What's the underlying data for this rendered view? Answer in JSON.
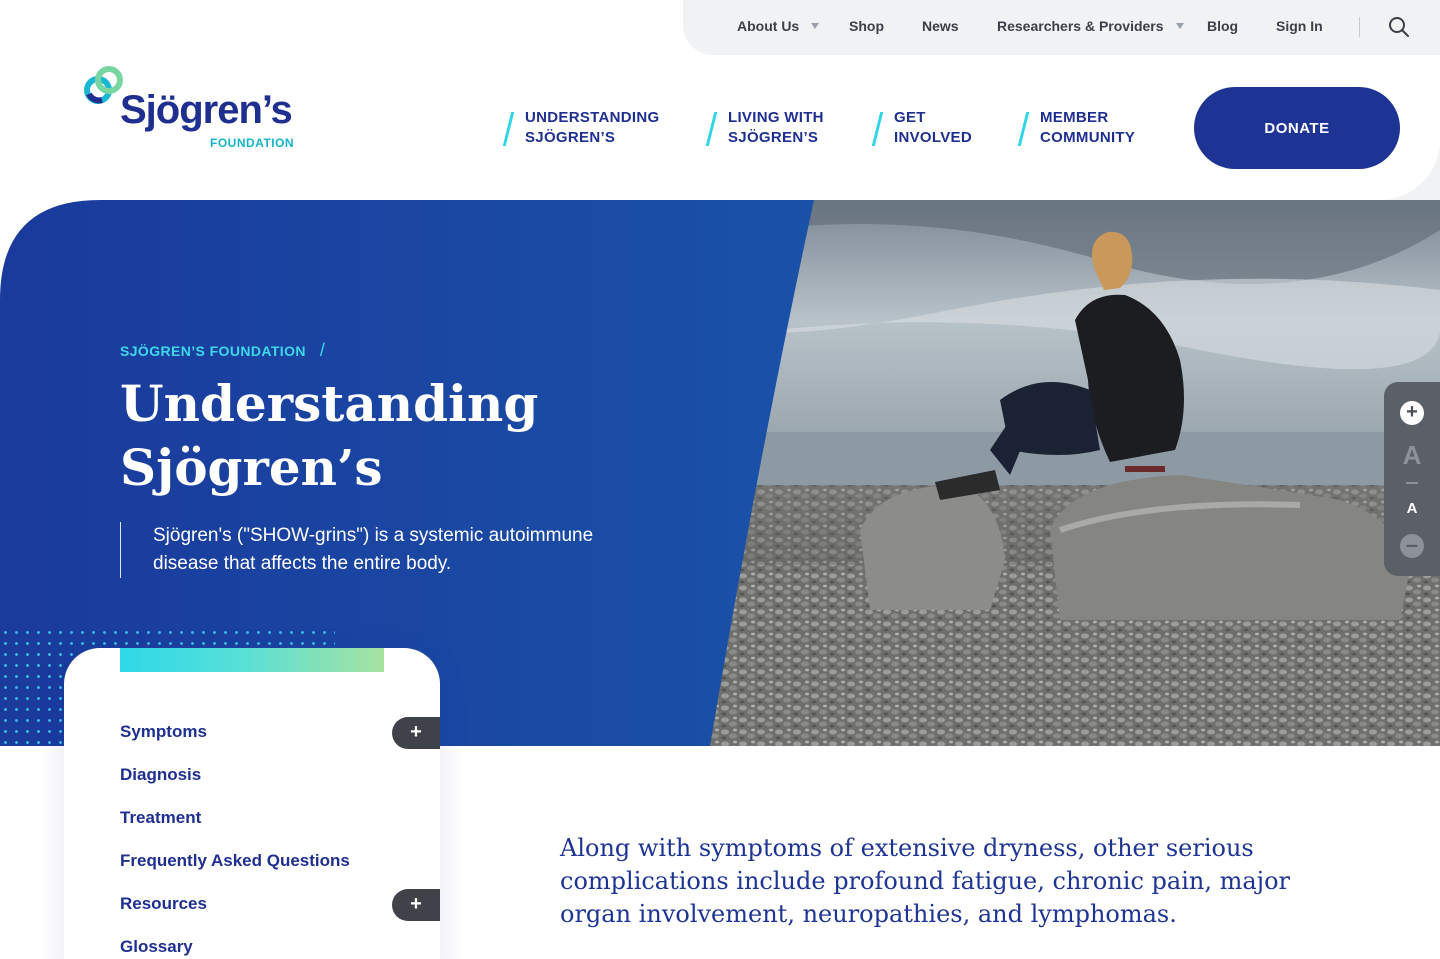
{
  "utility_nav": {
    "items": [
      {
        "label": "About Us",
        "has_dropdown": true
      },
      {
        "label": "Shop",
        "has_dropdown": false
      },
      {
        "label": "News",
        "has_dropdown": false
      },
      {
        "label": "Researchers & Providers",
        "has_dropdown": true
      },
      {
        "label": "Blog",
        "has_dropdown": false
      },
      {
        "label": "Sign In",
        "has_dropdown": false
      }
    ],
    "search_icon": "search-icon"
  },
  "logo": {
    "word": "Sjögren’s",
    "sub": "FOUNDATION"
  },
  "main_nav": {
    "items": [
      {
        "line1": "UNDERSTANDING",
        "line2": "SJÖGREN’S"
      },
      {
        "line1": "LIVING WITH",
        "line2": "SJÖGREN’S"
      },
      {
        "line1": "GET",
        "line2": "INVOLVED"
      },
      {
        "line1": "MEMBER",
        "line2": "COMMUNITY"
      }
    ],
    "donate_label": "DONATE"
  },
  "hero": {
    "breadcrumb": "SJÖGREN’S FOUNDATION",
    "breadcrumb_sep": "/",
    "title_line1": "Understanding",
    "title_line2": "Sjögren’s",
    "description": "Sjögren's (\"SHOW-grins\") is a systemic autoimmune disease that affects the entire body."
  },
  "font_control": {
    "increase_icon": "plus-circle-icon",
    "large_label": "A",
    "small_label": "A",
    "decrease_icon": "minus-circle-icon"
  },
  "sidebar": {
    "items": [
      {
        "label": "Symptoms",
        "expandable": true
      },
      {
        "label": "Diagnosis",
        "expandable": false
      },
      {
        "label": "Treatment",
        "expandable": false
      },
      {
        "label": "Frequently Asked Questions",
        "expandable": false
      },
      {
        "label": "Resources",
        "expandable": true
      },
      {
        "label": "Glossary",
        "expandable": false
      }
    ],
    "toggle_symbol": "+"
  },
  "intro": {
    "text": "Along with symptoms of extensive dryness, other serious complications include profound fatigue, chronic pain, major organ involvement, neuropathies, and lymphomas."
  },
  "colors": {
    "brand_navy": "#1e2f8f",
    "hero_blue": "#1a47a6",
    "accent_cyan": "#2fd5e4",
    "utility_bg": "#f1f2f4"
  }
}
